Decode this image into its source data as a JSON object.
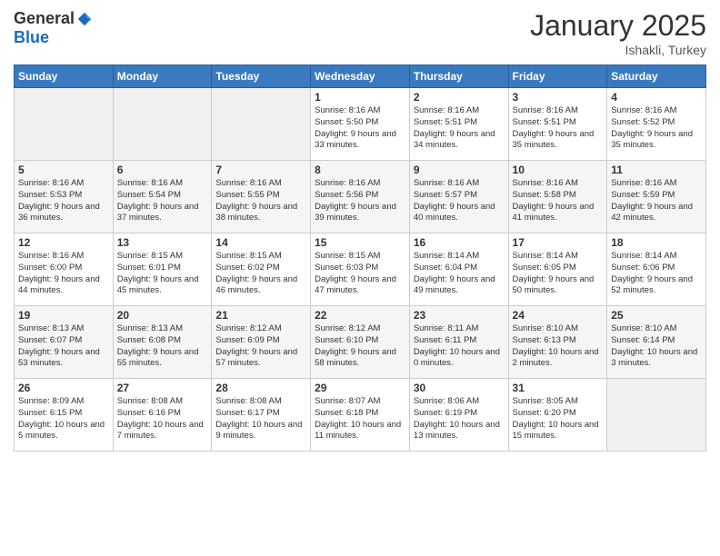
{
  "logo": {
    "general": "General",
    "blue": "Blue"
  },
  "header": {
    "month": "January 2025",
    "location": "Ishakli, Turkey"
  },
  "days_of_week": [
    "Sunday",
    "Monday",
    "Tuesday",
    "Wednesday",
    "Thursday",
    "Friday",
    "Saturday"
  ],
  "weeks": [
    [
      {
        "day": "",
        "empty": true
      },
      {
        "day": "",
        "empty": true
      },
      {
        "day": "",
        "empty": true
      },
      {
        "day": "1",
        "sunrise": "8:16 AM",
        "sunset": "5:50 PM",
        "daylight": "9 hours and 33 minutes."
      },
      {
        "day": "2",
        "sunrise": "8:16 AM",
        "sunset": "5:51 PM",
        "daylight": "9 hours and 34 minutes."
      },
      {
        "day": "3",
        "sunrise": "8:16 AM",
        "sunset": "5:51 PM",
        "daylight": "9 hours and 35 minutes."
      },
      {
        "day": "4",
        "sunrise": "8:16 AM",
        "sunset": "5:52 PM",
        "daylight": "9 hours and 35 minutes."
      }
    ],
    [
      {
        "day": "5",
        "sunrise": "8:16 AM",
        "sunset": "5:53 PM",
        "daylight": "9 hours and 36 minutes."
      },
      {
        "day": "6",
        "sunrise": "8:16 AM",
        "sunset": "5:54 PM",
        "daylight": "9 hours and 37 minutes."
      },
      {
        "day": "7",
        "sunrise": "8:16 AM",
        "sunset": "5:55 PM",
        "daylight": "9 hours and 38 minutes."
      },
      {
        "day": "8",
        "sunrise": "8:16 AM",
        "sunset": "5:56 PM",
        "daylight": "9 hours and 39 minutes."
      },
      {
        "day": "9",
        "sunrise": "8:16 AM",
        "sunset": "5:57 PM",
        "daylight": "9 hours and 40 minutes."
      },
      {
        "day": "10",
        "sunrise": "8:16 AM",
        "sunset": "5:58 PM",
        "daylight": "9 hours and 41 minutes."
      },
      {
        "day": "11",
        "sunrise": "8:16 AM",
        "sunset": "5:59 PM",
        "daylight": "9 hours and 42 minutes."
      }
    ],
    [
      {
        "day": "12",
        "sunrise": "8:16 AM",
        "sunset": "6:00 PM",
        "daylight": "9 hours and 44 minutes."
      },
      {
        "day": "13",
        "sunrise": "8:15 AM",
        "sunset": "6:01 PM",
        "daylight": "9 hours and 45 minutes."
      },
      {
        "day": "14",
        "sunrise": "8:15 AM",
        "sunset": "6:02 PM",
        "daylight": "9 hours and 46 minutes."
      },
      {
        "day": "15",
        "sunrise": "8:15 AM",
        "sunset": "6:03 PM",
        "daylight": "9 hours and 47 minutes."
      },
      {
        "day": "16",
        "sunrise": "8:14 AM",
        "sunset": "6:04 PM",
        "daylight": "9 hours and 49 minutes."
      },
      {
        "day": "17",
        "sunrise": "8:14 AM",
        "sunset": "6:05 PM",
        "daylight": "9 hours and 50 minutes."
      },
      {
        "day": "18",
        "sunrise": "8:14 AM",
        "sunset": "6:06 PM",
        "daylight": "9 hours and 52 minutes."
      }
    ],
    [
      {
        "day": "19",
        "sunrise": "8:13 AM",
        "sunset": "6:07 PM",
        "daylight": "9 hours and 53 minutes."
      },
      {
        "day": "20",
        "sunrise": "8:13 AM",
        "sunset": "6:08 PM",
        "daylight": "9 hours and 55 minutes."
      },
      {
        "day": "21",
        "sunrise": "8:12 AM",
        "sunset": "6:09 PM",
        "daylight": "9 hours and 57 minutes."
      },
      {
        "day": "22",
        "sunrise": "8:12 AM",
        "sunset": "6:10 PM",
        "daylight": "9 hours and 58 minutes."
      },
      {
        "day": "23",
        "sunrise": "8:11 AM",
        "sunset": "6:11 PM",
        "daylight": "10 hours and 0 minutes."
      },
      {
        "day": "24",
        "sunrise": "8:10 AM",
        "sunset": "6:13 PM",
        "daylight": "10 hours and 2 minutes."
      },
      {
        "day": "25",
        "sunrise": "8:10 AM",
        "sunset": "6:14 PM",
        "daylight": "10 hours and 3 minutes."
      }
    ],
    [
      {
        "day": "26",
        "sunrise": "8:09 AM",
        "sunset": "6:15 PM",
        "daylight": "10 hours and 5 minutes."
      },
      {
        "day": "27",
        "sunrise": "8:08 AM",
        "sunset": "6:16 PM",
        "daylight": "10 hours and 7 minutes."
      },
      {
        "day": "28",
        "sunrise": "8:08 AM",
        "sunset": "6:17 PM",
        "daylight": "10 hours and 9 minutes."
      },
      {
        "day": "29",
        "sunrise": "8:07 AM",
        "sunset": "6:18 PM",
        "daylight": "10 hours and 11 minutes."
      },
      {
        "day": "30",
        "sunrise": "8:06 AM",
        "sunset": "6:19 PM",
        "daylight": "10 hours and 13 minutes."
      },
      {
        "day": "31",
        "sunrise": "8:05 AM",
        "sunset": "6:20 PM",
        "daylight": "10 hours and 15 minutes."
      },
      {
        "day": "",
        "empty": true
      }
    ]
  ]
}
